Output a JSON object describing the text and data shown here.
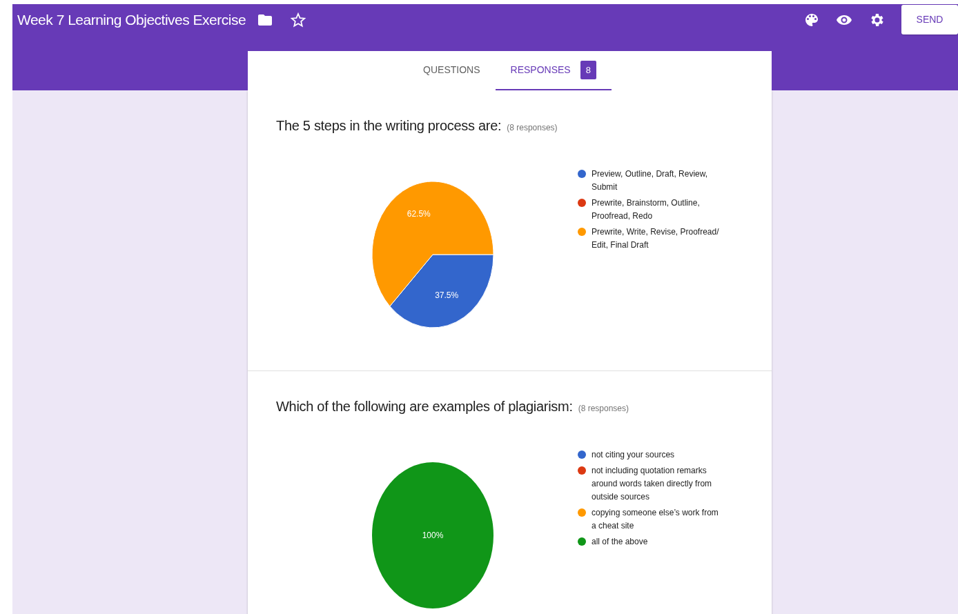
{
  "form": {
    "title": "Week 7 Learning Objectives Exercise",
    "send_label": "SEND"
  },
  "tabs": [
    {
      "label": "QUESTIONS",
      "selected": false
    },
    {
      "label": "RESPONSES",
      "selected": true,
      "count": "8"
    }
  ],
  "questions": [
    {
      "title": "The 5 steps in the writing process are:",
      "responses": "(8 responses)",
      "chart_data": {
        "type": "pie",
        "categories": [
          "Preview, Outline, Draft, Review, Submit",
          "Prewrite, Brainstorm, Outline, Proofread, Redo",
          "Prewrite, Write, Revise, Proofread/ Edit, Final Draft"
        ],
        "values": [
          37.5,
          0,
          62.5
        ],
        "colors": [
          "#3366cc",
          "#dc3912",
          "#ff9900"
        ],
        "value_labels": [
          "37.5%",
          null,
          "62.5%"
        ]
      }
    },
    {
      "title": "Which of the following are examples of plagiarism:",
      "responses": "(8 responses)",
      "chart_data": {
        "type": "pie",
        "categories": [
          "not citing your sources",
          "not including quotation remarks around words taken directly from outside sources",
          "copying someone else’s work from a cheat site",
          "all of the above"
        ],
        "values": [
          0,
          0,
          0,
          100
        ],
        "colors": [
          "#3366cc",
          "#dc3912",
          "#ff9900",
          "#109618"
        ],
        "value_labels": [
          null,
          null,
          null,
          "100%"
        ]
      }
    }
  ]
}
